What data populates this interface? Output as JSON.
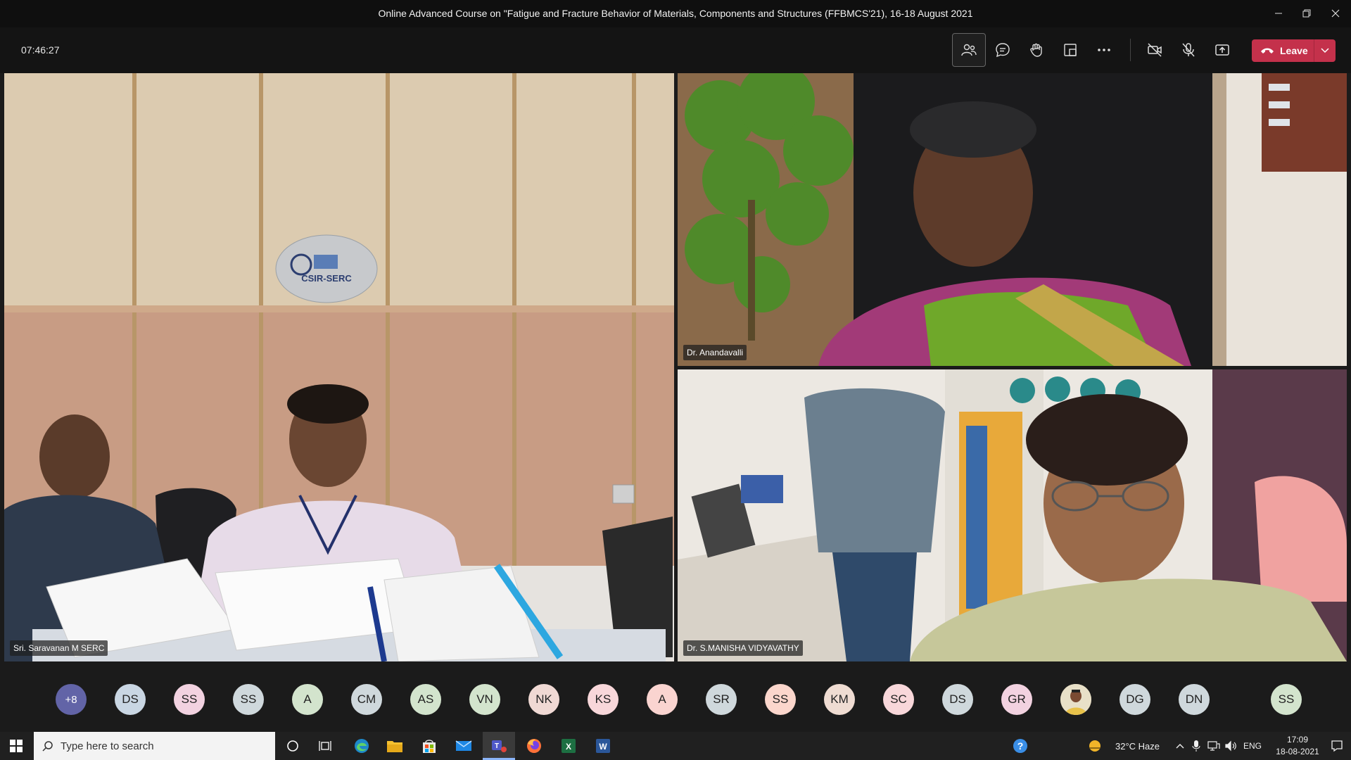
{
  "window": {
    "title": "Online Advanced Course on \"Fatigue and Fracture Behavior of Materials, Components and Structures (FFBMCS'21), 16-18 August 2021"
  },
  "toolbar": {
    "timer": "07:46:27",
    "leave_label": "Leave",
    "buttons": [
      "people-icon",
      "chat-icon",
      "raise-hand-icon",
      "rooms-icon",
      "more-icon",
      "camera-off-icon",
      "mic-off-icon",
      "share-icon"
    ]
  },
  "videos": [
    {
      "name": "Sri. Saravanan M SERC",
      "sign": "CSIR-SERC"
    },
    {
      "name": "Dr. Anandavalli"
    },
    {
      "name": "Dr. S.MANISHA VIDYAVATHY"
    }
  ],
  "participants": [
    {
      "initials": "+8",
      "color": "#6264a7"
    },
    {
      "initials": "DS",
      "color": "#c9d6e3"
    },
    {
      "initials": "SS",
      "color": "#f2d2e0"
    },
    {
      "initials": "SS",
      "color": "#cfd8dc"
    },
    {
      "initials": "A",
      "color": "#d3e4cd"
    },
    {
      "initials": "CM",
      "color": "#cfd8dc"
    },
    {
      "initials": "AS",
      "color": "#d3e4cd"
    },
    {
      "initials": "VN",
      "color": "#d3e4cd"
    },
    {
      "initials": "NK",
      "color": "#f0d9d4"
    },
    {
      "initials": "KS",
      "color": "#f8d7da"
    },
    {
      "initials": "A",
      "color": "#fad4d0"
    },
    {
      "initials": "SR",
      "color": "#cfd8dc"
    },
    {
      "initials": "SS",
      "color": "#fbd6cc"
    },
    {
      "initials": "KM",
      "color": "#efdcd2"
    },
    {
      "initials": "SC",
      "color": "#f8d7da"
    },
    {
      "initials": "DS",
      "color": "#cfd8dc"
    },
    {
      "initials": "GR",
      "color": "#f2d2e0"
    },
    {
      "initials": "",
      "color": "#d9c6a0",
      "photo": true
    },
    {
      "initials": "DG",
      "color": "#cfd8dc"
    },
    {
      "initials": "DN",
      "color": "#cfd8dc"
    },
    {
      "initials": "SS",
      "color": "#d3e4cd"
    }
  ],
  "taskbar": {
    "search_placeholder": "Type here to search",
    "weather": "32°C  Haze",
    "language": "ENG",
    "time": "17:09",
    "date": "18-08-2021"
  },
  "colors": {
    "leave": "#c4314b",
    "titlebar": "#0f0f0f",
    "stage": "#1b1b1b"
  }
}
